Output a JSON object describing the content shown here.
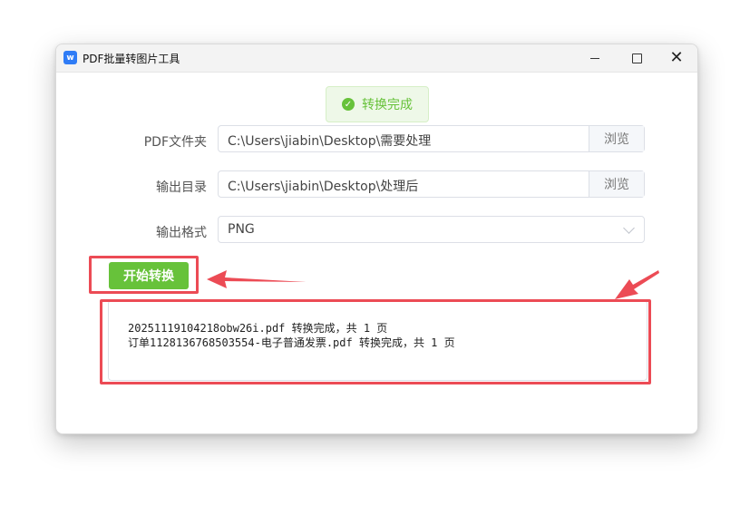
{
  "window": {
    "title": "PDF批量转图片工具",
    "app_icon_letter": "w"
  },
  "toast": {
    "text": "转换完成",
    "icon": "check-circle-icon",
    "color": "#67c23a"
  },
  "form": {
    "pdf_folder": {
      "label": "PDF文件夹",
      "value": "C:\\Users\\jiabin\\Desktop\\需要处理",
      "browse_label": "浏览"
    },
    "output_dir": {
      "label": "输出目录",
      "value": "C:\\Users\\jiabin\\Desktop\\处理后",
      "browse_label": "浏览"
    },
    "output_format": {
      "label": "输出格式",
      "value": "PNG"
    }
  },
  "actions": {
    "start_label": "开始转换"
  },
  "log": {
    "lines": [
      "20251119104218obw26i.pdf 转换完成，共 1 页",
      "订单1128136768503554-电子普通发票.pdf 转换完成，共 1 页"
    ]
  },
  "annotations": {
    "highlight_color": "#ec4b55"
  }
}
